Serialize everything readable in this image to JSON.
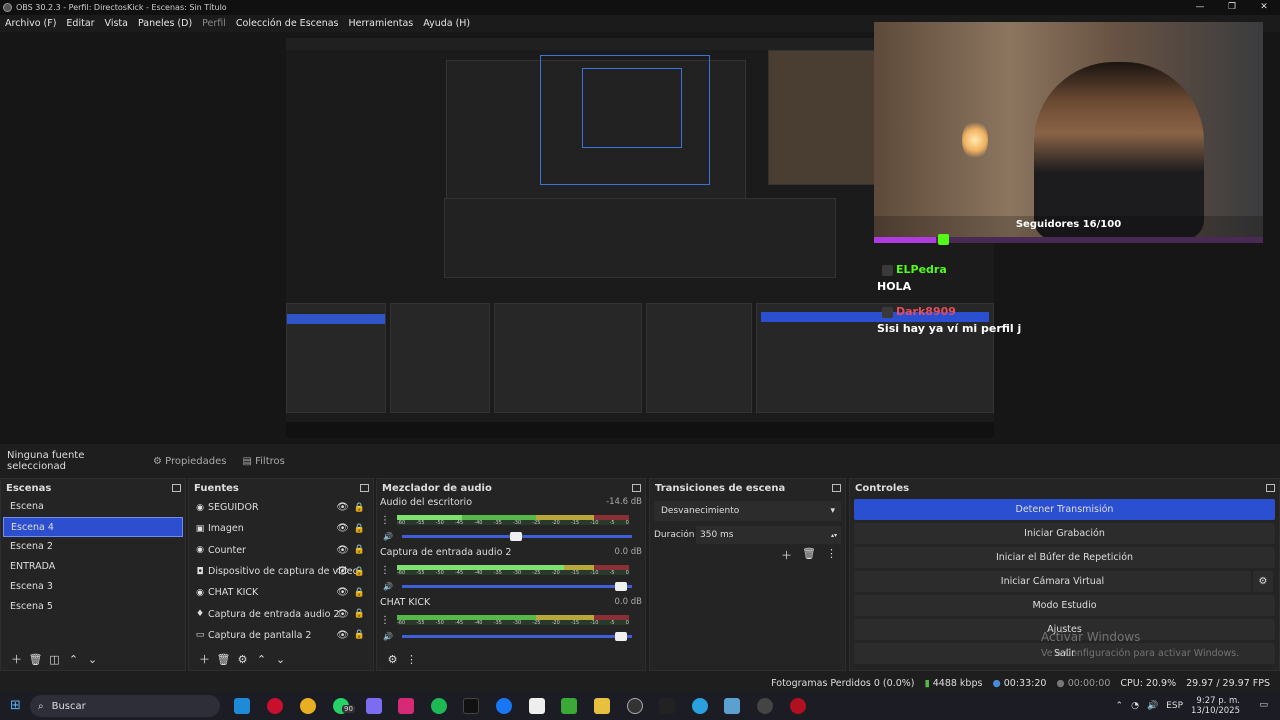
{
  "window": {
    "title": "OBS 30.2.3 - Perfil: DirectosKick - Escenas: Sin Título",
    "controls": [
      "—",
      "❐",
      "✕"
    ]
  },
  "menu": [
    "Archivo (F)",
    "Editar",
    "Vista",
    "Paneles (D)",
    "Perfil",
    "Colección de Escenas",
    "Herramientas",
    "Ayuda (H)"
  ],
  "overlay": {
    "followers": "Seguidores 16/100",
    "followers_progress": 0.16,
    "chat": [
      {
        "user": "ELPedra",
        "message": "HOLA"
      },
      {
        "user": "Dark8909",
        "message": "Sisi hay ya ví mi perfil j"
      }
    ]
  },
  "properties_bar": {
    "label": "Ninguna fuente seleccionad",
    "properties": "Propiedades",
    "filters": "Filtros"
  },
  "scenes": {
    "title": "Escenas",
    "items": [
      "Escena",
      "Escena 4",
      "Escena 2",
      "ENTRADA",
      "Escena 3",
      "Escena 5"
    ],
    "active_index": 1
  },
  "sources": {
    "title": "Fuentes",
    "items": [
      {
        "label": "SEGUIDOR",
        "icon": "browser-icon"
      },
      {
        "label": "Imagen",
        "icon": "image-icon"
      },
      {
        "label": "Counter",
        "icon": "browser-icon"
      },
      {
        "label": "Dispositivo de captura de video",
        "icon": "camera-icon"
      },
      {
        "label": "CHAT KICK",
        "icon": "browser-icon"
      },
      {
        "label": "Captura de entrada audio 2",
        "icon": "microphone-icon"
      },
      {
        "label": "Captura de pantalla 2",
        "icon": "monitor-icon"
      }
    ]
  },
  "mixer": {
    "title": "Mezclador de audio",
    "ticks": [
      "-60",
      "-55",
      "-50",
      "-45",
      "-40",
      "-35",
      "-30",
      "-25",
      "-20",
      "-15",
      "-10",
      "-5",
      "0"
    ],
    "channels": [
      {
        "name": "Audio del escritorio",
        "db": "-14.6 dB",
        "level": 0.28,
        "volume": 0.52
      },
      {
        "name": "Captura de entrada audio 2",
        "db": "0.0 dB",
        "level": 0.72,
        "volume": 0.98
      },
      {
        "name": "CHAT KICK",
        "db": "0.0 dB",
        "level": 0.0,
        "volume": 0.98
      }
    ]
  },
  "transitions": {
    "title": "Transiciones de escena",
    "selected": "Desvanecimiento",
    "duration_label": "Duración",
    "duration_value": "350 ms"
  },
  "controls": {
    "title": "Controles",
    "buttons": [
      "Detener Transmisión",
      "Iniciar Grabación",
      "Iniciar el Búfer de Repetición",
      "Iniciar Cámara Virtual",
      "Modo Estudio",
      "Ajustes",
      "Salir"
    ]
  },
  "watermark": {
    "line1": "Activar Windows",
    "line2": "Ve a Configuración para activar Windows."
  },
  "status": {
    "dropped": "Fotogramas Perdidos 0 (0.0%)",
    "bitrate": "4488 kbps",
    "live": "00:33:20",
    "rec": "00:00:00",
    "cpu": "CPU: 20.9%",
    "fps": "29.97 / 29.97 FPS"
  },
  "taskbar": {
    "search": "Buscar",
    "badge": "90",
    "lang": "ESP",
    "time": "9:27 p. m.",
    "date": "13/10/2025"
  }
}
